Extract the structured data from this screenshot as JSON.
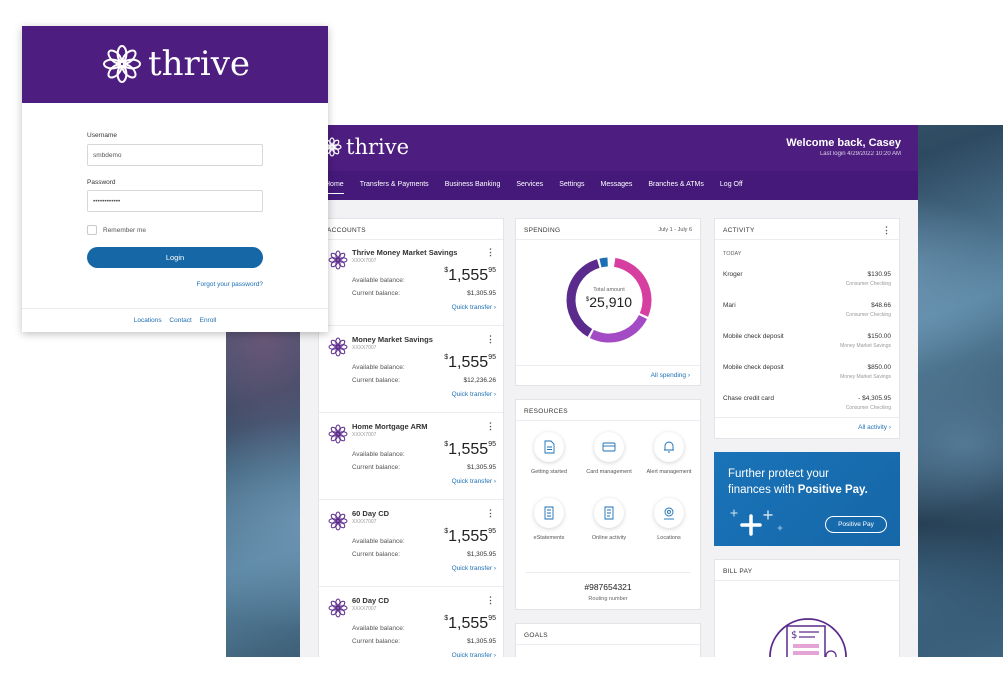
{
  "login": {
    "brand": "thrive",
    "username_label": "Username",
    "username_value": "smbdemo",
    "password_label": "Password",
    "password_value": "••••••••••••",
    "remember_label": "Remember me",
    "login_button": "Login",
    "forgot_link": "Forgot your password?",
    "footer_links": [
      "Locations",
      "Contact",
      "Enroll"
    ]
  },
  "dashboard": {
    "brand": "thrive",
    "welcome": "Welcome back, Casey",
    "last_login": "Last login 4/29/2022 10:20 AM",
    "nav": [
      "Home",
      "Transfers & Payments",
      "Business Banking",
      "Services",
      "Settings",
      "Messages",
      "Branches & ATMs",
      "Log Off"
    ],
    "accounts": {
      "title": "Accounts",
      "available_label": "Available balance:",
      "current_label": "Current balance:",
      "quick_transfer": "Quick transfer ›",
      "items": [
        {
          "name": "Thrive Money Market Savings",
          "number": "XXXX7007",
          "avail_dollars": "1,555",
          "avail_cents": "95",
          "current": "$1,305.95"
        },
        {
          "name": "Money Market Savings",
          "number": "XXXX7007",
          "avail_dollars": "1,555",
          "avail_cents": "95",
          "current": "$12,236.26"
        },
        {
          "name": "Home Mortgage ARM",
          "number": "XXXX7007",
          "avail_dollars": "1,555",
          "avail_cents": "95",
          "current": "$1,305.95"
        },
        {
          "name": "60 Day CD",
          "number": "XXXX7007",
          "avail_dollars": "1,555",
          "avail_cents": "95",
          "current": "$1,305.95"
        },
        {
          "name": "60 Day CD",
          "number": "XXXX7007",
          "avail_dollars": "1,555",
          "avail_cents": "95",
          "current": "$1,305.95"
        }
      ]
    },
    "spending": {
      "title": "Spending",
      "range": "July 1 - July 6",
      "total_label": "Total amount",
      "total_value": "25,910",
      "all_link": "All spending ›",
      "segments": [
        {
          "color": "#d63fa0",
          "fraction": 0.3
        },
        {
          "color": "#a34bc4",
          "fraction": 0.26
        },
        {
          "color": "#5a2a8c",
          "fraction": 0.38
        },
        {
          "color": "#1b6fb5",
          "fraction": 0.04
        }
      ]
    },
    "resources": {
      "title": "Resources",
      "items": [
        {
          "label": "Getting started",
          "icon": "document-icon"
        },
        {
          "label": "Card management",
          "icon": "card-icon"
        },
        {
          "label": "Alert management",
          "icon": "bell-icon"
        },
        {
          "label": "eStatements",
          "icon": "statement-icon"
        },
        {
          "label": "Online activity",
          "icon": "activity-icon"
        },
        {
          "label": "Locations",
          "icon": "location-icon"
        }
      ],
      "routing_value": "#987654321",
      "routing_label": "Routing number"
    },
    "goals": {
      "title": "Goals"
    },
    "activity": {
      "title": "Activity",
      "today": "Today",
      "all_link": "All activity ›",
      "items": [
        {
          "name": "Kroger",
          "amount": "$130.95",
          "account": "Consumer Checking"
        },
        {
          "name": "Mari",
          "amount": "$48.66",
          "account": "Consumer Checking"
        },
        {
          "name": "Mobile check deposit",
          "amount": "$150.00",
          "account": "Money Market Savings"
        },
        {
          "name": "Mobile check deposit",
          "amount": "$850.00",
          "account": "Money Market Savings"
        },
        {
          "name": "Chase credit card",
          "amount": "- $4,305.95",
          "account": "Consumer Checking"
        }
      ]
    },
    "positive_pay": {
      "line1": "Further protect your",
      "line2a": "finances with ",
      "line2b": "Positive Pay.",
      "button": "Positive Pay"
    },
    "bill_pay": {
      "title": "Bill Pay"
    },
    "colors": {
      "brand_purple": "#4d1d7f",
      "link_blue": "#1b6fb5",
      "button_blue": "#1667a6"
    }
  }
}
